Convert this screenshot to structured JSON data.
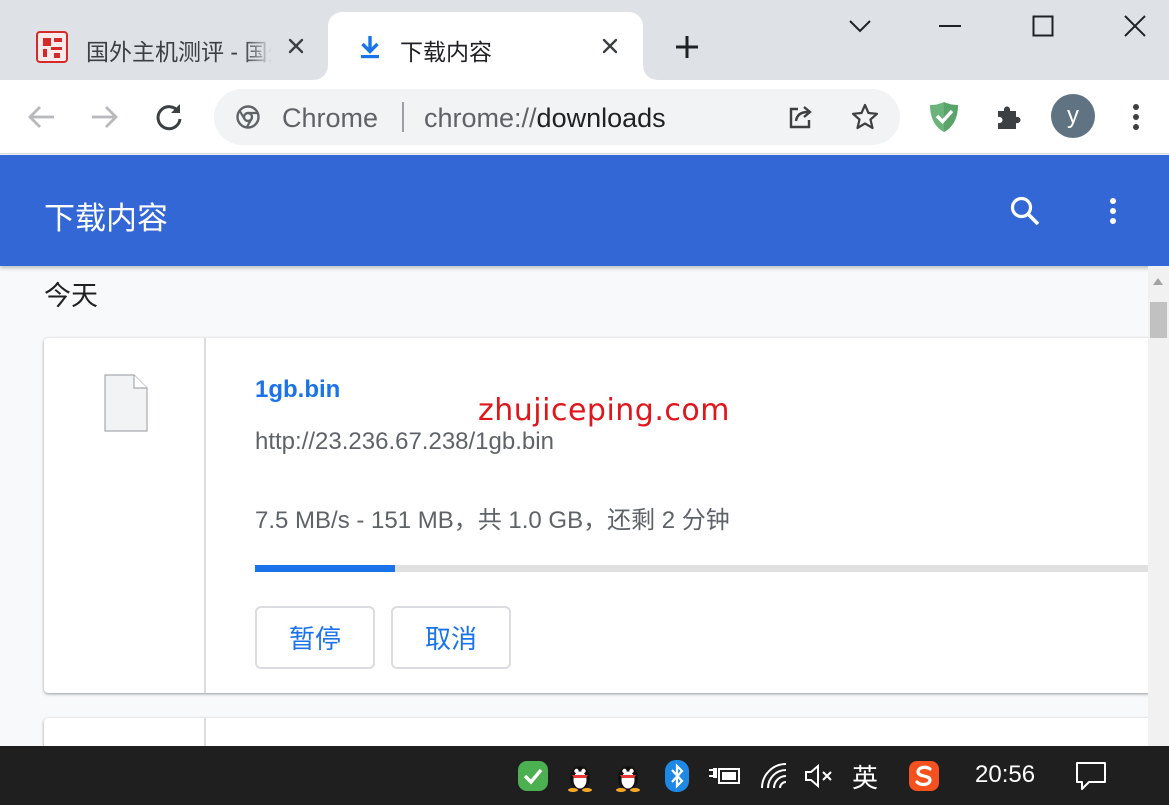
{
  "tabs": [
    {
      "title": "国外主机测评 - 国外",
      "active": false
    },
    {
      "title": "下载内容",
      "active": true
    }
  ],
  "omnibox": {
    "chip": "Chrome",
    "url_scheme": "chrome://",
    "url_path": "downloads"
  },
  "profile": {
    "initial": "y"
  },
  "page": {
    "title": "下载内容",
    "date_group": "今天"
  },
  "downloads": [
    {
      "file_name": "1gb.bin",
      "url": "http://23.236.67.238/1gb.bin",
      "status": "7.5 MB/s - 151 MB，共 1.0 GB，还剩 2 分钟",
      "progress_fraction": 0.155,
      "pause_label": "暂停",
      "cancel_label": "取消"
    }
  ],
  "watermark": "zhujiceping.com",
  "taskbar": {
    "ime_label": "英",
    "clock": "20:56"
  },
  "icons": {
    "tab1": "site-seal-favicon",
    "tab2": "download-favicon",
    "file": "file-icon",
    "extension_1": "shield-check-icon",
    "extensions": "puzzle-icon"
  },
  "colors": {
    "header_blue": "#3367d6",
    "link_blue": "#1a73e8",
    "progress_track": "#e0e0e0",
    "watermark_red": "#e0161b",
    "taskbar": "#1f1f1f"
  }
}
